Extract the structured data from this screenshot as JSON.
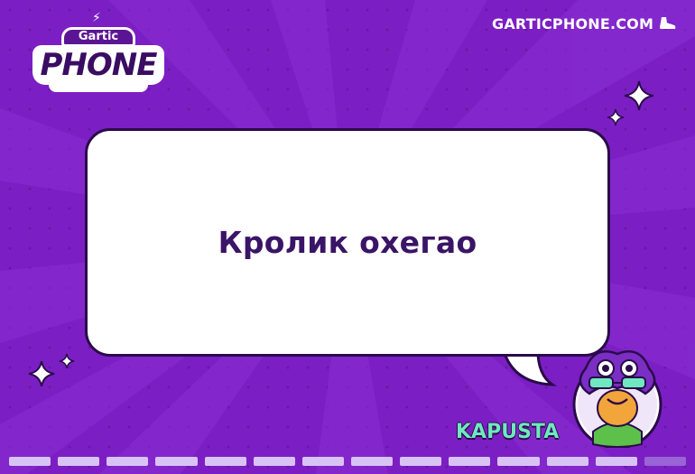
{
  "logo": {
    "top": "Gartic",
    "main": "PHONE"
  },
  "site": {
    "label": "GARTICPHONE.COM",
    "icon": "shoe-icon"
  },
  "phrase": "Кролик охегао",
  "player": {
    "name": "KAPUSTA",
    "avatar": "purple-flower-avatar-with-glasses"
  },
  "progress": {
    "segments": 14,
    "completed": 13
  },
  "colors": {
    "background": "#7b1fc4",
    "bubble": "#ffffff",
    "phrase": "#3a1466",
    "player_name": "#6fe8c0",
    "progress_done": "#d9c3f4",
    "progress_pending": "#9a63d6"
  }
}
